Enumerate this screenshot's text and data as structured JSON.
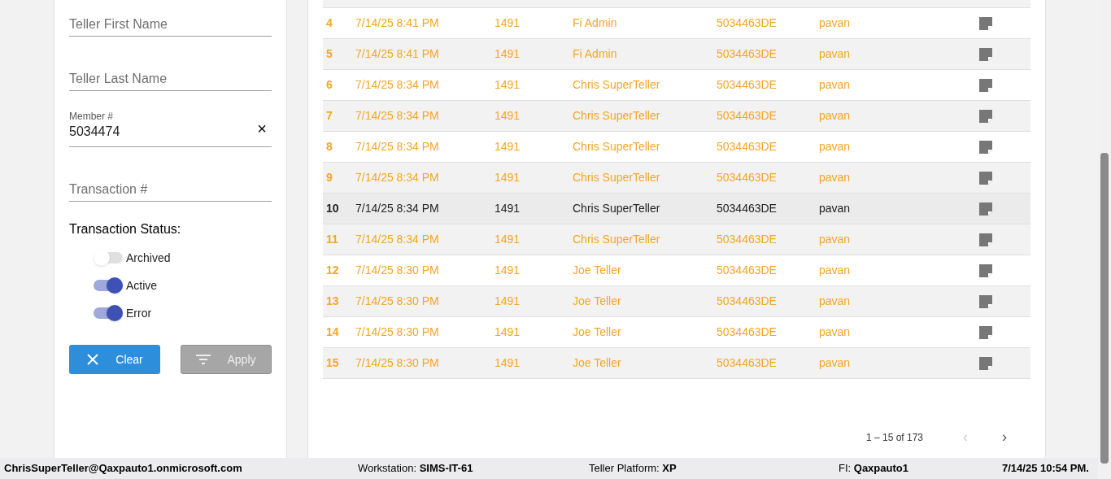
{
  "filters": {
    "first_name": {
      "placeholder": "Teller First Name"
    },
    "last_name": {
      "placeholder": "Teller Last Name"
    },
    "member": {
      "label": "Member #",
      "value": "5034474",
      "clear": "×"
    },
    "transaction": {
      "placeholder": "Transaction #"
    },
    "status_label": "Transaction Status:",
    "toggles": [
      {
        "label": "Archived",
        "on": false
      },
      {
        "label": "Active",
        "on": true
      },
      {
        "label": "Error",
        "on": true
      }
    ],
    "buttons": [
      {
        "label": "Clear",
        "kind": "clear",
        "disabled": false
      },
      {
        "label": "Apply",
        "kind": "apply",
        "disabled": true
      }
    ]
  },
  "table": {
    "rows": [
      {
        "num": "4",
        "date": "7/14/25 8:41 PM",
        "code": "1491",
        "teller": "Fi Admin",
        "member": "5034463DE",
        "user": "pavan",
        "selected": false
      },
      {
        "num": "5",
        "date": "7/14/25 8:41 PM",
        "code": "1491",
        "teller": "Fi Admin",
        "member": "5034463DE",
        "user": "pavan",
        "selected": false
      },
      {
        "num": "6",
        "date": "7/14/25 8:34 PM",
        "code": "1491",
        "teller": "Chris SuperTeller",
        "member": "5034463DE",
        "user": "pavan",
        "selected": false
      },
      {
        "num": "7",
        "date": "7/14/25 8:34 PM",
        "code": "1491",
        "teller": "Chris SuperTeller",
        "member": "5034463DE",
        "user": "pavan",
        "selected": false
      },
      {
        "num": "8",
        "date": "7/14/25 8:34 PM",
        "code": "1491",
        "teller": "Chris SuperTeller",
        "member": "5034463DE",
        "user": "pavan",
        "selected": false
      },
      {
        "num": "9",
        "date": "7/14/25 8:34 PM",
        "code": "1491",
        "teller": "Chris SuperTeller",
        "member": "5034463DE",
        "user": "pavan",
        "selected": false
      },
      {
        "num": "10",
        "date": "7/14/25 8:34 PM",
        "code": "1491",
        "teller": "Chris SuperTeller",
        "member": "5034463DE",
        "user": "pavan",
        "selected": true
      },
      {
        "num": "11",
        "date": "7/14/25 8:34 PM",
        "code": "1491",
        "teller": "Chris SuperTeller",
        "member": "5034463DE",
        "user": "pavan",
        "selected": false
      },
      {
        "num": "12",
        "date": "7/14/25 8:30 PM",
        "code": "1491",
        "teller": "Joe Teller",
        "member": "5034463DE",
        "user": "pavan",
        "selected": false
      },
      {
        "num": "13",
        "date": "7/14/25 8:30 PM",
        "code": "1491",
        "teller": "Joe Teller",
        "member": "5034463DE",
        "user": "pavan",
        "selected": false
      },
      {
        "num": "14",
        "date": "7/14/25 8:30 PM",
        "code": "1491",
        "teller": "Joe Teller",
        "member": "5034463DE",
        "user": "pavan",
        "selected": false
      },
      {
        "num": "15",
        "date": "7/14/25 8:30 PM",
        "code": "1491",
        "teller": "Joe Teller",
        "member": "5034463DE",
        "user": "pavan",
        "selected": false
      }
    ],
    "pagination": {
      "range": "1 – 15 of 173",
      "prev": "‹",
      "next": "›",
      "prev_disabled": true
    }
  },
  "status_bar": {
    "user": "ChrisSuperTeller@Qaxpauto1.onmicrosoft.com",
    "workstation_label": "Workstation:",
    "workstation": "SIMS-IT-61",
    "platform_label": "Teller Platform:",
    "platform": "XP",
    "fi_label": "FI:",
    "fi": "Qaxpauto1",
    "time": "7/14/25 10:54 PM."
  }
}
